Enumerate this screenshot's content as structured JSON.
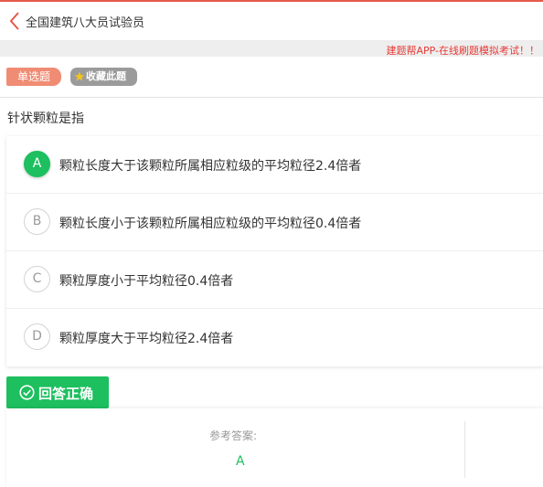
{
  "header": {
    "title": "全国建筑八大员试验员"
  },
  "ad": {
    "text": "建题帮APP-在线刷题模拟考试！！"
  },
  "tags": {
    "type_label": "单选题",
    "favorite_label": "收藏此题"
  },
  "question": {
    "text": "针状颗粒是指"
  },
  "options": [
    {
      "letter": "A",
      "text": "颗粒长度大于该颗粒所属相应粒级的平均粒径2.4倍者",
      "selected": true
    },
    {
      "letter": "B",
      "text": "颗粒长度小于该颗粒所属相应粒级的平均粒径0.4倍者",
      "selected": false
    },
    {
      "letter": "C",
      "text": "颗粒厚度小于平均粒径0.4倍者",
      "selected": false
    },
    {
      "letter": "D",
      "text": "颗粒厚度大于平均粒径2.4倍者",
      "selected": false
    }
  ],
  "result": {
    "label": "回答正确"
  },
  "answer": {
    "label": "参考答案:",
    "value": "A"
  },
  "colors": {
    "accent_green": "#1dbf5f",
    "back_red": "#e55a4a",
    "ad_red": "#e53935",
    "tag_salmon": "#f08c74",
    "star_yellow": "#f5c518"
  },
  "icons": {
    "back": "chevron-left-icon",
    "star": "star-icon",
    "check": "check-circle-icon"
  }
}
